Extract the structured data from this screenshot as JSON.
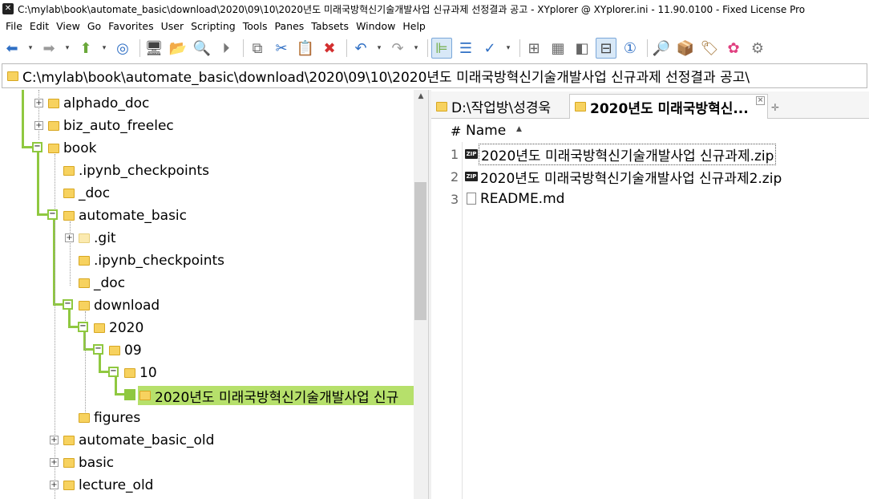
{
  "window": {
    "title": "C:\\mylab\\book\\automate_basic\\download\\2020\\09\\10\\2020년도 미래국방혁신기술개발사업 신규과제 선정결과 공고 - XYplorer @ XYplorer.ini - 11.90.0100 - Fixed License Pro"
  },
  "menu": [
    "File",
    "Edit",
    "View",
    "Go",
    "Favorites",
    "User",
    "Scripting",
    "Tools",
    "Panes",
    "Tabsets",
    "Window",
    "Help"
  ],
  "address": {
    "path": "C:\\mylab\\book\\automate_basic\\download\\2020\\09\\10\\2020년도 미래국방혁신기술개발사업 신규과제 선정결과 공고\\"
  },
  "tree": {
    "items": [
      {
        "label": "alphado_doc"
      },
      {
        "label": "biz_auto_freelec"
      },
      {
        "label": "book"
      },
      {
        "label": ".ipynb_checkpoints"
      },
      {
        "label": "_doc"
      },
      {
        "label": "automate_basic"
      },
      {
        "label": ".git"
      },
      {
        "label": ".ipynb_checkpoints"
      },
      {
        "label": "_doc"
      },
      {
        "label": "download"
      },
      {
        "label": "2020"
      },
      {
        "label": "09"
      },
      {
        "label": "10"
      },
      {
        "label": "2020년도 미래국방혁신기술개발사업 신규"
      },
      {
        "label": "figures"
      },
      {
        "label": "automate_basic_old"
      },
      {
        "label": "basic"
      },
      {
        "label": "lecture_old"
      }
    ]
  },
  "tabs": [
    {
      "label": "D:\\작업방\\성경욱"
    },
    {
      "label": "2020년도 미래국방혁신..."
    }
  ],
  "list": {
    "columns": {
      "num": "#",
      "name": "Name"
    },
    "files": [
      {
        "num": "1",
        "name": "2020년도 미래국방혁신기술개발사업 신규과제.zip",
        "icon": "zip-icon",
        "icon_text": "ZIP"
      },
      {
        "num": "2",
        "name": "2020년도 미래국방혁신기술개발사업 신규과제2.zip",
        "icon": "zip-icon",
        "icon_text": "ZIP"
      },
      {
        "num": "3",
        "name": "README.md",
        "icon": "document-icon",
        "icon_text": ""
      }
    ]
  },
  "colors": {
    "tree_line": "#8fc840",
    "selection": "#b6e06b",
    "folder": "#f7d25f"
  }
}
